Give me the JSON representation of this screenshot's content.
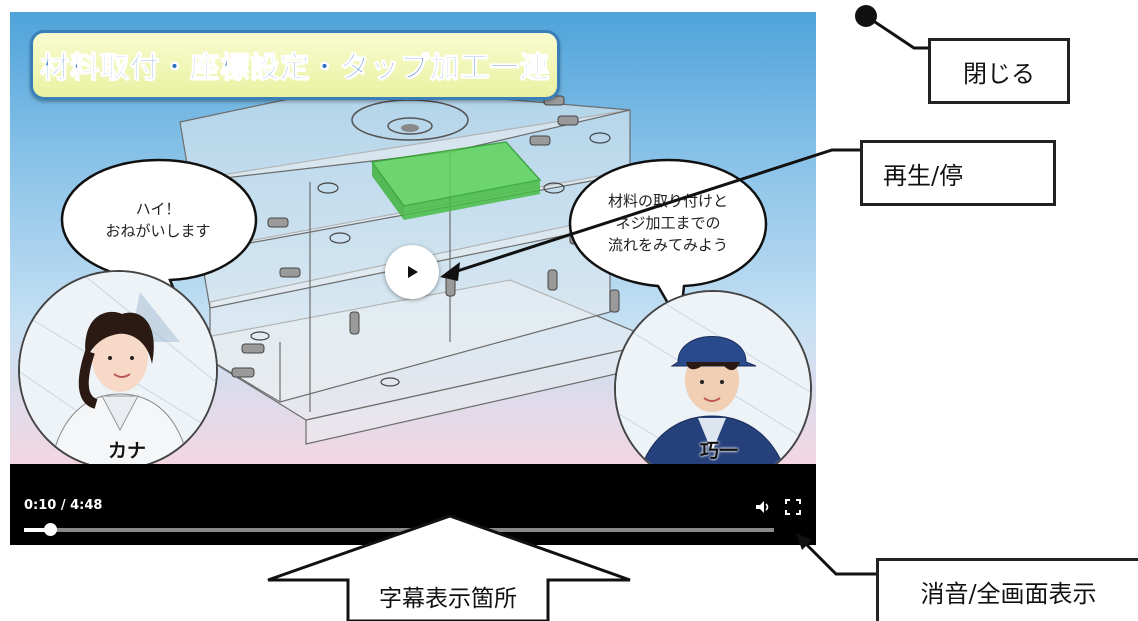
{
  "video": {
    "title": "材料取付・座標設定・タップ加工一連",
    "speech_left": "ハイ！\nおねがいします",
    "speech_right": "材料の取り付けと\nネジ加工までの\n流れをみてみよう",
    "speaker_left_name": "カナ",
    "speaker_right_name": "巧一"
  },
  "controls": {
    "time_display": "0:10 / 4:48",
    "current_seconds": 10,
    "duration_seconds": 288,
    "progress_fraction": 0.035,
    "volume_icon": "speaker-icon",
    "fullscreen_icon": "fullscreen-icon",
    "play_icon": "play-icon"
  },
  "annotations": {
    "close": "閉じる",
    "play_pause": "再生/停",
    "subtitle_area": "字幕表示箇所",
    "mute_fullscreen": "消音/全画面表示"
  },
  "colors": {
    "title_text": "#2d6fc0",
    "title_border": "#3a7fb8",
    "highlight_part": "#4cc84a",
    "control_bar": "#000000"
  }
}
